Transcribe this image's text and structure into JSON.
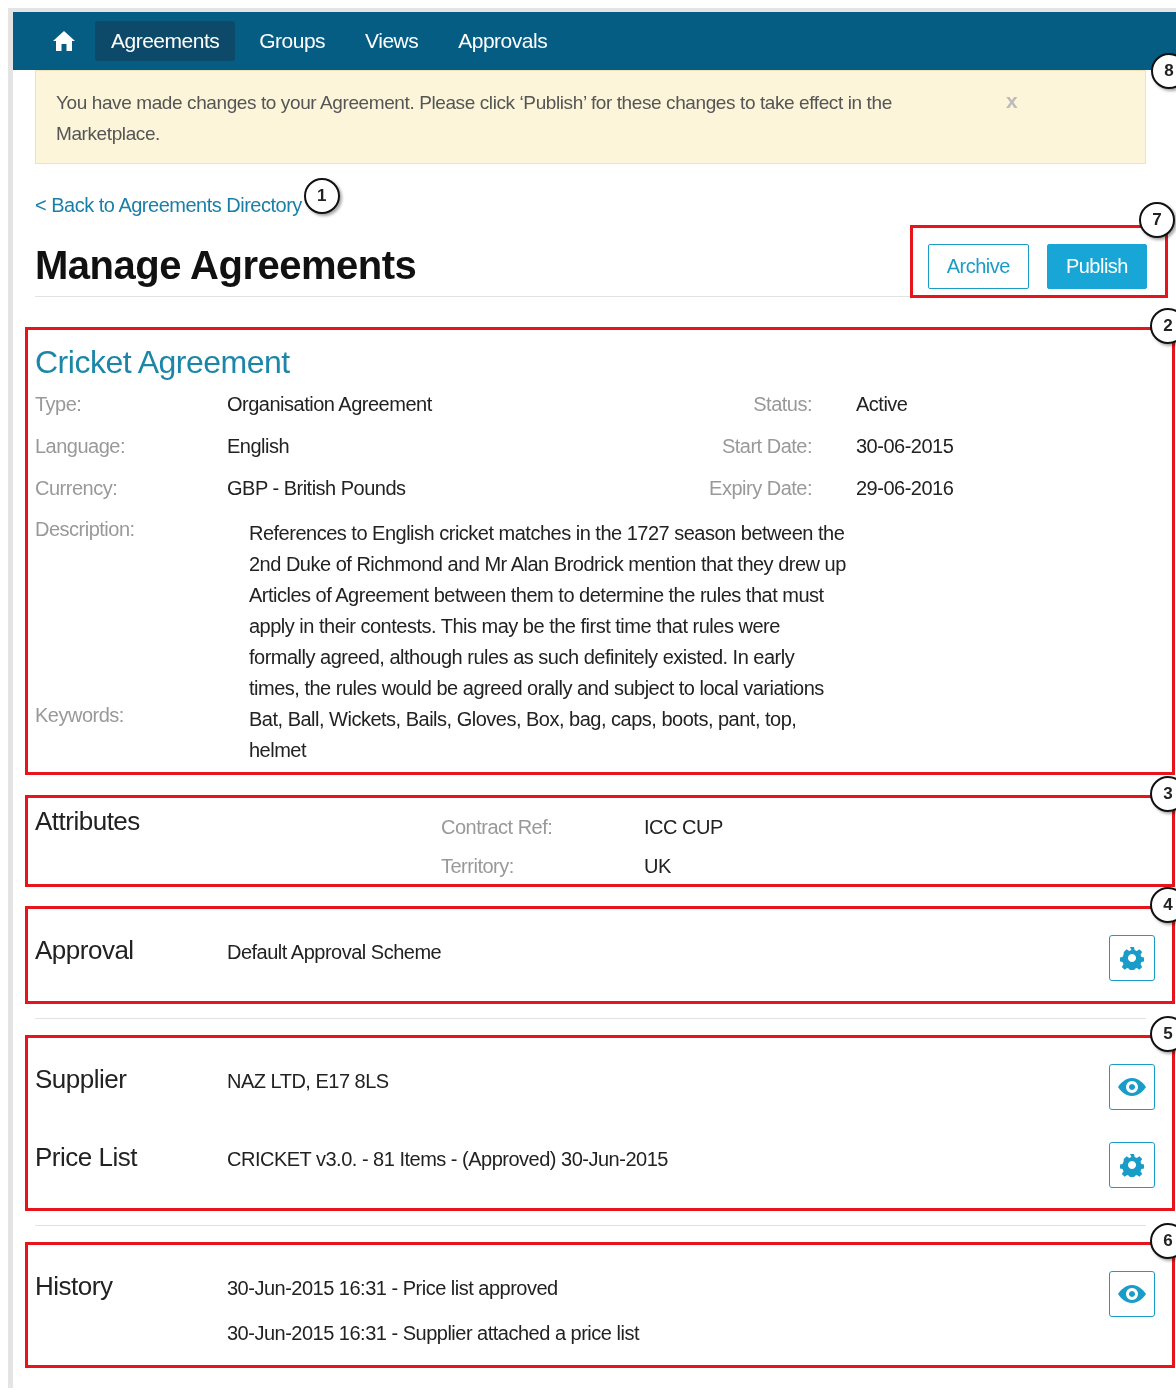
{
  "nav": {
    "items": [
      {
        "kind": "home",
        "selected": false
      },
      {
        "kind": "link",
        "label": "Agreements",
        "selected": true
      },
      {
        "kind": "link",
        "label": "Groups",
        "selected": false
      },
      {
        "kind": "link",
        "label": "Views",
        "selected": false
      },
      {
        "kind": "link",
        "label": "Approvals",
        "selected": false
      }
    ]
  },
  "notice": {
    "text": "You have made changes to your Agreement. Please click ‘Publish’ for these changes to take effect in the Marketplace.",
    "close": "x",
    "callout": "8"
  },
  "back_link": {
    "label": "< Back to Agreements Directory",
    "callout": "1"
  },
  "title": "Manage Agreements",
  "actions": {
    "callout": "7",
    "buttons": [
      {
        "label": "Archive",
        "kind": "outline"
      },
      {
        "label": "Publish",
        "kind": "primary"
      }
    ]
  },
  "agreement": {
    "callout": "2",
    "name": "Cricket Agreement",
    "rows": [
      {
        "label": "Type:",
        "value": "Organisation Agreement",
        "label_2": "Status:",
        "value_2": "Active"
      },
      {
        "label": "Language:",
        "value": "English",
        "label_2": "Start Date:",
        "value_2": "30-06-2015"
      },
      {
        "label": "Currency:",
        "value": "GBP - British Pounds",
        "label_2": "Expiry Date:",
        "value_2": "29-06-2016"
      }
    ],
    "description": {
      "label": "Description:",
      "value": "References to English cricket matches in the 1727 season between the 2nd Duke of Richmond and Mr Alan Brodrick mention that they drew up Articles of Agreement between them to determine the rules that must apply in their contests. This may be the first time that rules were formally agreed, although rules as such definitely existed. In early times, the rules would be agreed orally and subject to local variations"
    },
    "keywords": {
      "label": "Keywords:",
      "value": "Bat, Ball, Wickets, Bails, Gloves, Box, bag, caps, boots, pant, top, helmet"
    }
  },
  "attributes": {
    "callout": "3",
    "heading": "Attributes",
    "items": [
      {
        "label": "Contract Ref:",
        "value": "ICC CUP"
      },
      {
        "label": "Territory:",
        "value": "UK"
      }
    ]
  },
  "sections": [
    {
      "callout": "4",
      "divider": false,
      "rows": [
        {
          "heading": "Approval",
          "value": "Default Approval Scheme",
          "kind": "settings"
        }
      ]
    },
    {
      "callout": "5",
      "divider": true,
      "rows": [
        {
          "heading": "Supplier",
          "value": "NAZ LTD, E17 8LS",
          "kind": "view"
        },
        {
          "heading": "Price List",
          "value": "CRICKET v3.0. - 81 Items - (Approved) 30-Jun-2015",
          "kind": "settings"
        }
      ]
    },
    {
      "callout": "6",
      "divider": true,
      "rows": [
        {
          "heading": "History",
          "lines": [
            "30-Jun-2015 16:31 - Price list approved",
            "30-Jun-2015 16:31 - Supplier attached a price list"
          ],
          "kind": "view"
        }
      ]
    }
  ]
}
